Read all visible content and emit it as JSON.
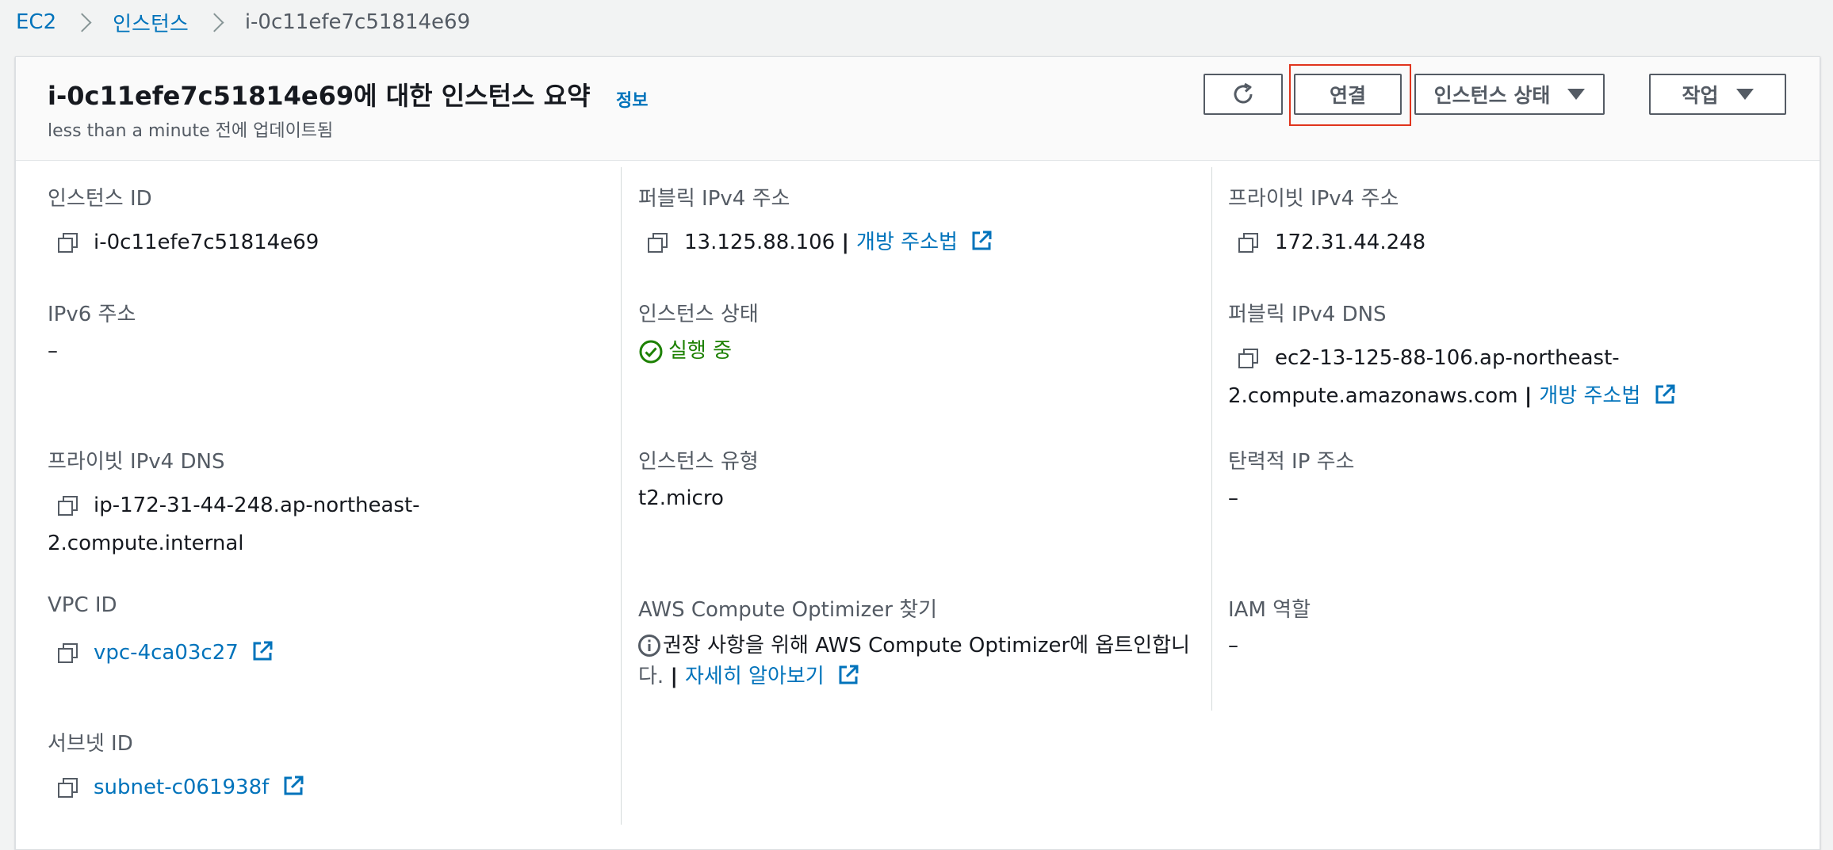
{
  "breadcrumb": {
    "items": [
      "EC2",
      "인스턴스",
      "i-0c11efe7c51814e69"
    ]
  },
  "header": {
    "title": "i-0c11efe7c51814e69에 대한 인스턴스 요약",
    "info_link": "정보",
    "subtitle": "less than a minute 전에 업데이트됨",
    "buttons": {
      "refresh_icon": "refresh-icon",
      "connect": "연결",
      "instance_state": "인스턴스 상태",
      "actions": "작업"
    }
  },
  "details": {
    "instance_id": {
      "label": "인스턴스 ID",
      "value": "i-0c11efe7c51814e69"
    },
    "public_ipv4": {
      "label": "퍼블릭 IPv4 주소",
      "value": "13.125.88.106",
      "link": "개방 주소법"
    },
    "private_ipv4": {
      "label": "프라이빗 IPv4 주소",
      "value": "172.31.44.248"
    },
    "ipv6": {
      "label": "IPv6 주소",
      "value": "–"
    },
    "instance_state": {
      "label": "인스턴스 상태",
      "value": "실행 중"
    },
    "public_dns": {
      "label": "퍼블릭 IPv4 DNS",
      "value_line1": "ec2-13-125-88-106.ap-northeast-",
      "value_line2": "2.compute.amazonaws.com",
      "link": "개방 주소법"
    },
    "private_dns": {
      "label": "프라이빗 IPv4 DNS",
      "value_line1": "ip-172-31-44-248.ap-northeast-",
      "value_line2": "2.compute.internal"
    },
    "instance_type": {
      "label": "인스턴스 유형",
      "value": "t2.micro"
    },
    "elastic_ip": {
      "label": "탄력적 IP 주소",
      "value": "–"
    },
    "vpc_id": {
      "label": "VPC ID",
      "value": "vpc-4ca03c27"
    },
    "optimizer": {
      "label": "AWS Compute Optimizer 찾기",
      "text_line1": "권장 사항을 위해 AWS Compute Optimizer에 옵트인합니",
      "text_line2": "다.",
      "link": "자세히 알아보기"
    },
    "iam_role": {
      "label": "IAM 역할",
      "value": "–"
    },
    "subnet_id": {
      "label": "서브넷 ID",
      "value": "subnet-c061938f"
    }
  },
  "colors": {
    "link": "#0073bb",
    "success": "#1d8102",
    "highlight": "#e0341d"
  }
}
